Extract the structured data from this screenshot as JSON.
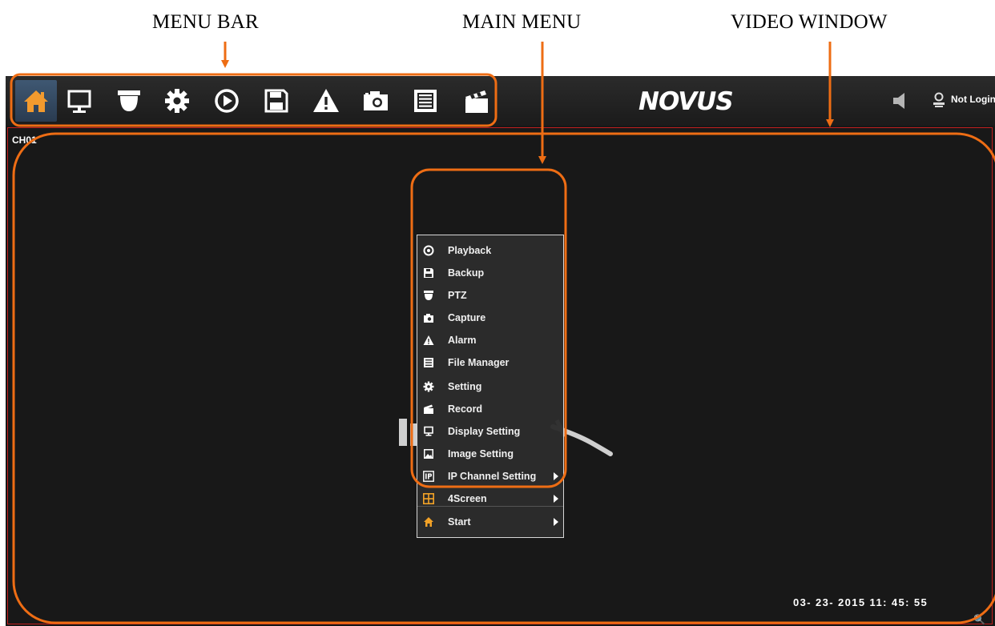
{
  "annotations": {
    "menu_bar": "MENU BAR",
    "main_menu": "MAIN MENU",
    "video_window": "VIDEO WINDOW"
  },
  "toolbar": {
    "icons": [
      "home-icon",
      "monitor-icon",
      "ptz-camera-icon",
      "gear-icon",
      "playback-icon",
      "save-icon",
      "alarm-icon",
      "camera-icon",
      "file-manager-icon",
      "clapperboard-icon"
    ],
    "active": "home-icon"
  },
  "header": {
    "logo": "NOVUS",
    "login_status": "Not Login"
  },
  "video": {
    "channel": "CH01",
    "datetime": "03- 23- 2015  11: 45: 55"
  },
  "context_menu": {
    "items": [
      {
        "label": "Playback",
        "icon": "playback-icon"
      },
      {
        "label": "Backup",
        "icon": "save-icon"
      },
      {
        "label": "PTZ",
        "icon": "ptz-camera-icon"
      },
      {
        "label": "Capture",
        "icon": "camera-icon"
      },
      {
        "label": "Alarm",
        "icon": "alarm-icon"
      },
      {
        "label": "File Manager",
        "icon": "file-manager-icon"
      },
      {
        "label": "Setting",
        "icon": "gear-icon"
      },
      {
        "label": "Record",
        "icon": "clapperboard-icon"
      },
      {
        "label": "Display Setting",
        "icon": "monitor-icon"
      },
      {
        "label": "Image Setting",
        "icon": "image-icon"
      },
      {
        "label": "IP Channel Setting",
        "icon": "ip-icon",
        "submenu": true
      },
      {
        "label": "4Screen",
        "icon": "grid-icon",
        "submenu": true
      },
      {
        "label": "Start",
        "icon": "home-icon",
        "submenu": true
      }
    ]
  },
  "colors": {
    "accent": "#ee6d14",
    "video_border": "#c21f1f",
    "active_button": "#3f5873"
  }
}
